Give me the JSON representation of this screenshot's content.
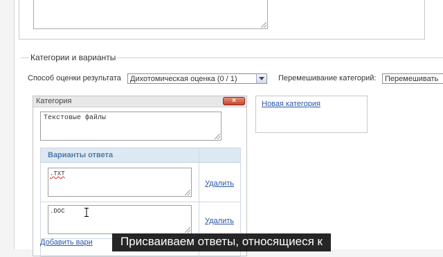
{
  "section": {
    "title": "Категории и варианты"
  },
  "scoring": {
    "label": "Способ оценки результата",
    "selected": "Дихотомическая оценка (0 / 1)"
  },
  "shuffle": {
    "label": "Перемешивание категорий:",
    "selected": "Перемешивать"
  },
  "category_dialog": {
    "title": "Категория",
    "close_label": "×",
    "category_value": "Текстовые файлы",
    "answers_header": "Варианты ответа",
    "answers": [
      {
        "value": ".TXT",
        "delete_label": "Удалить"
      },
      {
        "value": ".DOC",
        "delete_label": "Удалить"
      }
    ],
    "add_link": "Добавить вари"
  },
  "new_category": {
    "link": "Новая категория"
  },
  "subtitle": "Присваиваем ответы, относящиеся к",
  "icons": {
    "dropdown": "chevron-down-icon",
    "close": "close-icon",
    "cursor": "text-cursor-icon",
    "resize": "resize-grip-icon"
  }
}
